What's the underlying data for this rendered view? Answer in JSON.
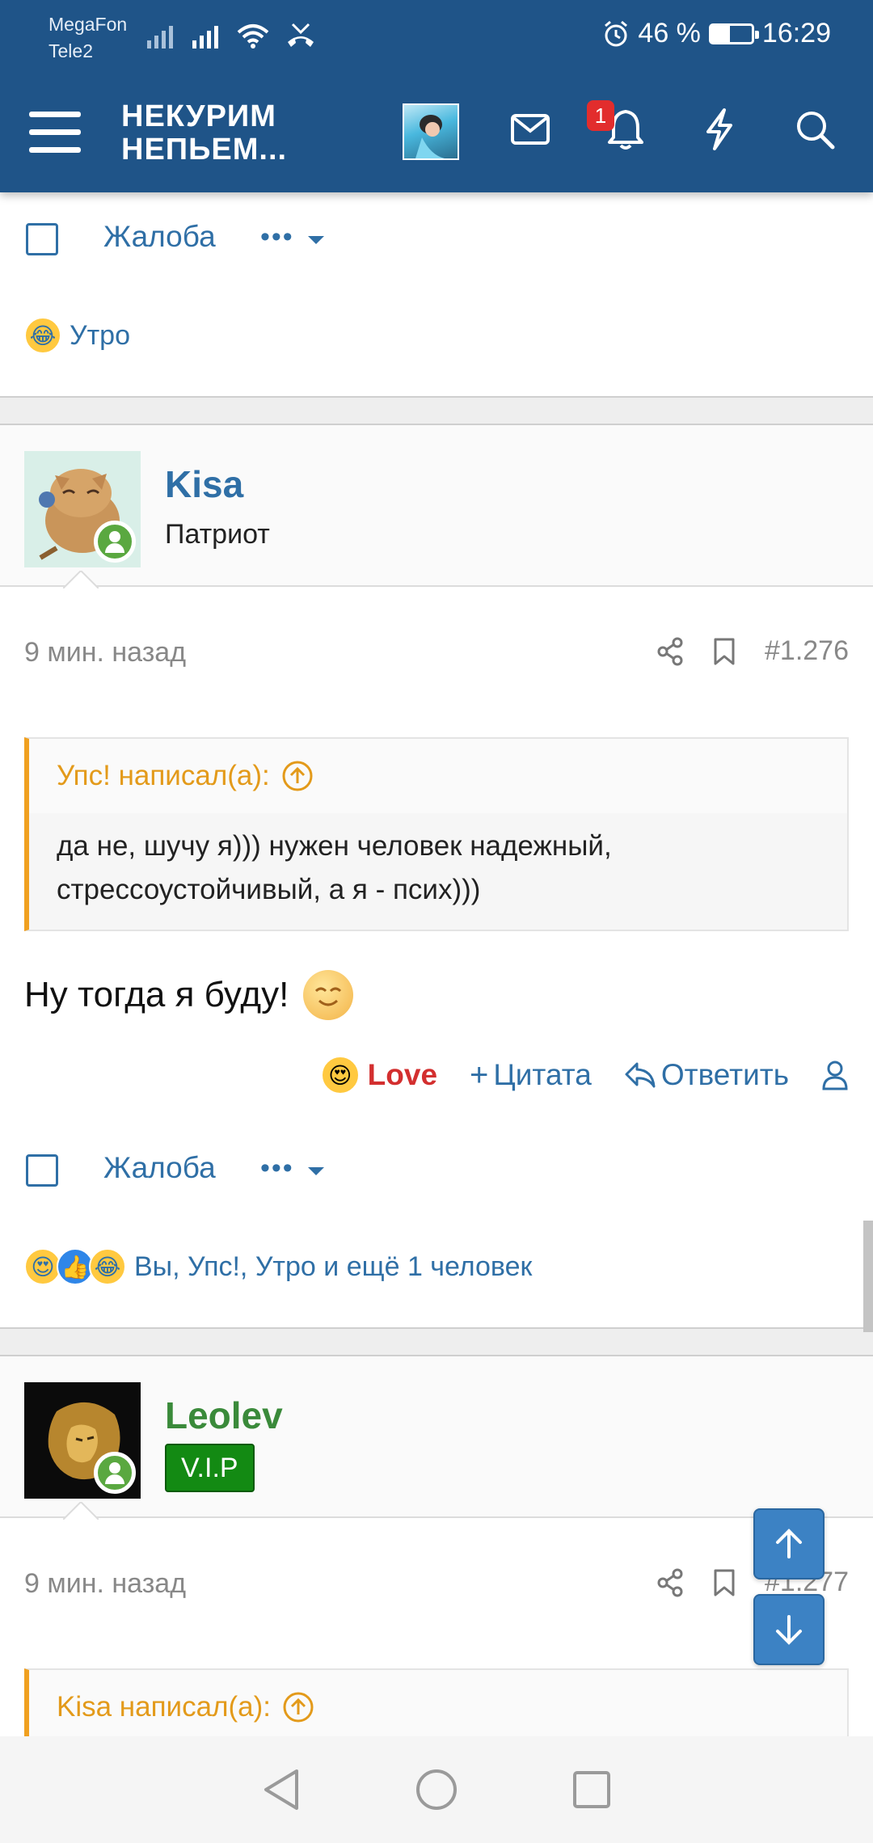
{
  "status_bar": {
    "carrier1": "MegaFon",
    "carrier2": "Tele2",
    "battery_text": "46 %",
    "battery_level": 0.46,
    "time": "16:29"
  },
  "header": {
    "logo_line1": "НЕКУРИМ",
    "logo_line2": "НЕПЬЕМ...",
    "notification_count": "1",
    "colors": {
      "bar": "#1f5488",
      "badge": "#e22d2d"
    }
  },
  "prev_post": {
    "report_label": "Жалоба",
    "more_label": "•••",
    "reaction_emojis": [
      "rofl"
    ],
    "reaction_text": "Утро"
  },
  "post1": {
    "username": "Kisa",
    "user_title": "Патриот",
    "username_color": "#2f6fa6",
    "time": "9 мин. назад",
    "number": "#1.276",
    "quote_author": "Упс! написал(а):",
    "quote_text": "да не, шучу я))) нужен человек надежный, стрессоустойчивый, а я - псих)))",
    "message": "Ну тогда я буду!",
    "reaction_given": "Love",
    "quote_action": "Цитата",
    "reply_action": "Ответить",
    "report_label": "Жалоба",
    "more_label": "•••",
    "reaction_emojis": [
      "heart-eyes",
      "thumbs-up",
      "rofl"
    ],
    "reaction_text": "Вы, Упс!, Утро и ещё 1 человек"
  },
  "post2": {
    "username": "Leolev",
    "username_color": "#3a8a3a",
    "badge": "V.I.P",
    "time": "9 мин. назад",
    "number": "#1.277",
    "quote_author": "Kisa написал(а):"
  },
  "colors": {
    "link": "#2f6fa6",
    "quote_accent": "#f0a020",
    "love": "#d32f2f"
  }
}
